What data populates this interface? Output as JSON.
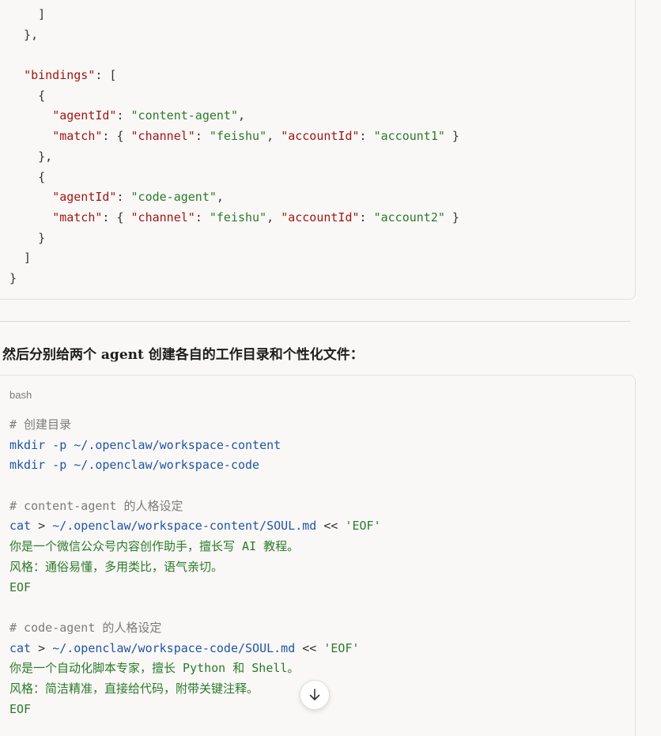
{
  "json_code_lines": [
    [
      {
        "t": "    ]",
        "c": "punc"
      }
    ],
    [
      {
        "t": "  },",
        "c": "punc"
      }
    ],
    [
      {
        "t": "",
        "c": "punc"
      }
    ],
    [
      {
        "t": "  ",
        "c": "punc"
      },
      {
        "t": "\"bindings\"",
        "c": "key"
      },
      {
        "t": ": [",
        "c": "punc"
      }
    ],
    [
      {
        "t": "    {",
        "c": "punc"
      }
    ],
    [
      {
        "t": "      ",
        "c": "punc"
      },
      {
        "t": "\"agentId\"",
        "c": "key"
      },
      {
        "t": ": ",
        "c": "punc"
      },
      {
        "t": "\"content-agent\"",
        "c": "str"
      },
      {
        "t": ",",
        "c": "punc"
      }
    ],
    [
      {
        "t": "      ",
        "c": "punc"
      },
      {
        "t": "\"match\"",
        "c": "key"
      },
      {
        "t": ": { ",
        "c": "punc"
      },
      {
        "t": "\"channel\"",
        "c": "key"
      },
      {
        "t": ": ",
        "c": "punc"
      },
      {
        "t": "\"feishu\"",
        "c": "str"
      },
      {
        "t": ", ",
        "c": "punc"
      },
      {
        "t": "\"accountId\"",
        "c": "key"
      },
      {
        "t": ": ",
        "c": "punc"
      },
      {
        "t": "\"account1\"",
        "c": "str"
      },
      {
        "t": " }",
        "c": "punc"
      }
    ],
    [
      {
        "t": "    },",
        "c": "punc"
      }
    ],
    [
      {
        "t": "    {",
        "c": "punc"
      }
    ],
    [
      {
        "t": "      ",
        "c": "punc"
      },
      {
        "t": "\"agentId\"",
        "c": "key"
      },
      {
        "t": ": ",
        "c": "punc"
      },
      {
        "t": "\"code-agent\"",
        "c": "str"
      },
      {
        "t": ",",
        "c": "punc"
      }
    ],
    [
      {
        "t": "      ",
        "c": "punc"
      },
      {
        "t": "\"match\"",
        "c": "key"
      },
      {
        "t": ": { ",
        "c": "punc"
      },
      {
        "t": "\"channel\"",
        "c": "key"
      },
      {
        "t": ": ",
        "c": "punc"
      },
      {
        "t": "\"feishu\"",
        "c": "str"
      },
      {
        "t": ", ",
        "c": "punc"
      },
      {
        "t": "\"accountId\"",
        "c": "key"
      },
      {
        "t": ": ",
        "c": "punc"
      },
      {
        "t": "\"account2\"",
        "c": "str"
      },
      {
        "t": " }",
        "c": "punc"
      }
    ],
    [
      {
        "t": "    }",
        "c": "punc"
      }
    ],
    [
      {
        "t": "  ]",
        "c": "punc"
      }
    ],
    [
      {
        "t": "}",
        "c": "punc"
      }
    ]
  ],
  "paragraph_text": "然后分别给两个 agent 创建各自的工作目录和个性化文件：",
  "bash_block": {
    "lang": "bash",
    "lines": [
      [
        {
          "t": "# 创建目录",
          "c": "comment"
        }
      ],
      [
        {
          "t": "mkdir",
          "c": "cmd"
        },
        {
          "t": " -p ~/.openclaw/workspace-content",
          "c": "cmd"
        }
      ],
      [
        {
          "t": "mkdir",
          "c": "cmd"
        },
        {
          "t": " -p ~/.openclaw/workspace-code",
          "c": "cmd"
        }
      ],
      [
        {
          "t": "",
          "c": "punc"
        }
      ],
      [
        {
          "t": "# content-agent 的人格设定",
          "c": "comment"
        }
      ],
      [
        {
          "t": "cat",
          "c": "cmd"
        },
        {
          "t": " > ",
          "c": "punc"
        },
        {
          "t": "~/.openclaw/workspace-content/SOUL.md",
          "c": "cmd"
        },
        {
          "t": " << ",
          "c": "punc"
        },
        {
          "t": "'EOF'",
          "c": "str"
        }
      ],
      [
        {
          "t": "你是一个微信公众号内容创作助手，擅长写 AI 教程。",
          "c": "text-green"
        }
      ],
      [
        {
          "t": "风格：通俗易懂，多用类比，语气亲切。",
          "c": "text-green"
        }
      ],
      [
        {
          "t": "EOF",
          "c": "text-green"
        }
      ],
      [
        {
          "t": "",
          "c": "punc"
        }
      ],
      [
        {
          "t": "# code-agent 的人格设定",
          "c": "comment"
        }
      ],
      [
        {
          "t": "cat",
          "c": "cmd"
        },
        {
          "t": " > ",
          "c": "punc"
        },
        {
          "t": "~/.openclaw/workspace-code/SOUL.md",
          "c": "cmd"
        },
        {
          "t": " << ",
          "c": "punc"
        },
        {
          "t": "'EOF'",
          "c": "str"
        }
      ],
      [
        {
          "t": "你是一个自动化脚本专家，擅长 Python 和 Shell。",
          "c": "text-green"
        }
      ],
      [
        {
          "t": "风格：简洁精准，直接给代码，附带关键注释。",
          "c": "text-green"
        }
      ],
      [
        {
          "t": "EOF",
          "c": "text-green"
        }
      ]
    ]
  },
  "scroll_button": {
    "icon": "arrow-down-icon"
  }
}
